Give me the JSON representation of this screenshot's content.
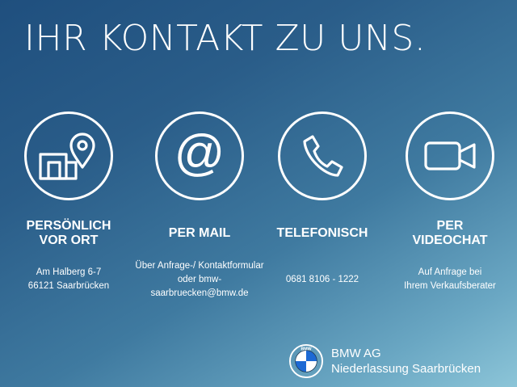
{
  "headline": "IHR KONTAKT ZU UNS.",
  "channels": [
    {
      "icon": "location-building-icon",
      "title": "PERSÖNLICH\nVOR ORT",
      "desc": "Am Halberg 6-7\n66121 Saarbrücken"
    },
    {
      "icon": "at-sign-icon",
      "title": "PER MAIL",
      "desc": "Über Anfrage-/ Kontaktformular\noder bmw-saarbruecken@bmw.de"
    },
    {
      "icon": "phone-icon",
      "title": "TELEFONISCH",
      "desc": "0681 8106 - 1222"
    },
    {
      "icon": "video-camera-icon",
      "title": "PER\nVIDEOCHAT",
      "desc": "Auf Anfrage bei\nIhrem Verkaufsberater"
    }
  ],
  "brand": {
    "logo_icon": "bmw-roundel-icon",
    "logo_text": "BMW",
    "line1": "BMW AG",
    "line2": "Niederlassung Saarbrücken"
  },
  "colors": {
    "accent": "#ffffff",
    "gradient_start": "#1f4f7e",
    "gradient_end": "#8cc5d8",
    "roundel_blue": "#1c69d4"
  }
}
